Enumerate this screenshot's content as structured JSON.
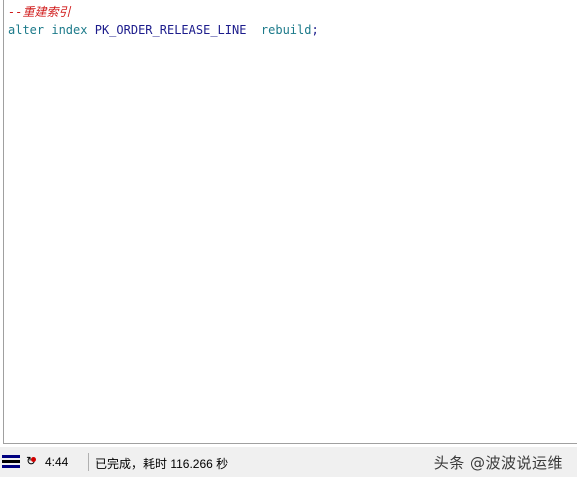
{
  "editor": {
    "comment_line": "--重建索引",
    "sql": {
      "keyword_alter": "alter",
      "keyword_index": "index",
      "identifier": "PK_ORDER_RELEASE_LINE",
      "keyword_rebuild": "rebuild",
      "terminator": ";"
    }
  },
  "statusbar": {
    "cursor_position": "4:44",
    "message": "已完成，耗时 116.266 秒",
    "icons": [
      "lines-icon",
      "refresh-icon"
    ]
  },
  "watermark": "头条 @波波说运维",
  "colors": {
    "comment": "#d01a1a",
    "keyword": "#1c7a8a",
    "identifier": "#1c1c8c",
    "statusbar_bg": "#f0f0f0"
  }
}
